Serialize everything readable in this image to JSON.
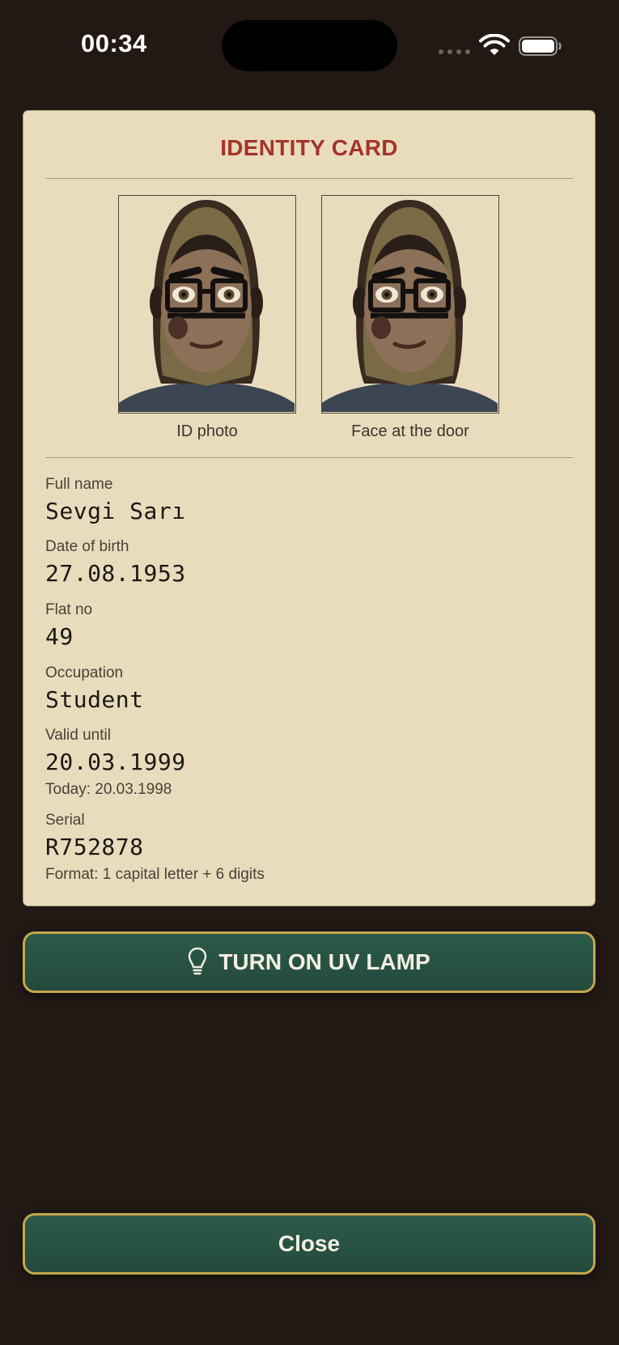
{
  "status_bar": {
    "time": "00:34",
    "icons": [
      "cellular-signal-icon",
      "wifi-icon",
      "battery-icon"
    ]
  },
  "card": {
    "title": "IDENTITY CARD",
    "photos": [
      {
        "caption": "ID photo"
      },
      {
        "caption": "Face at the door"
      }
    ],
    "fields": {
      "full_name": {
        "label": "Full name",
        "value": "Sevgi Sarı"
      },
      "date_of_birth": {
        "label": "Date of birth",
        "value": "27.08.1953"
      },
      "flat_no": {
        "label": "Flat no",
        "value": "49"
      },
      "occupation": {
        "label": "Occupation",
        "value": "Student"
      },
      "valid_until": {
        "label": "Valid until",
        "value": "20.03.1999",
        "note": "Today: 20.03.1998"
      },
      "serial": {
        "label": "Serial",
        "value": "R752878",
        "note": "Format: 1 capital letter + 6 digits"
      }
    }
  },
  "buttons": {
    "uv_lamp": {
      "label": "TURN ON UV LAMP",
      "icon": "lightbulb-icon"
    },
    "close": {
      "label": "Close"
    }
  },
  "colors": {
    "background": "#221915",
    "card": "#e8dcbd",
    "title_red": "#a6332a",
    "button_green": "#2c5a4a",
    "button_border": "#c4a64a"
  }
}
